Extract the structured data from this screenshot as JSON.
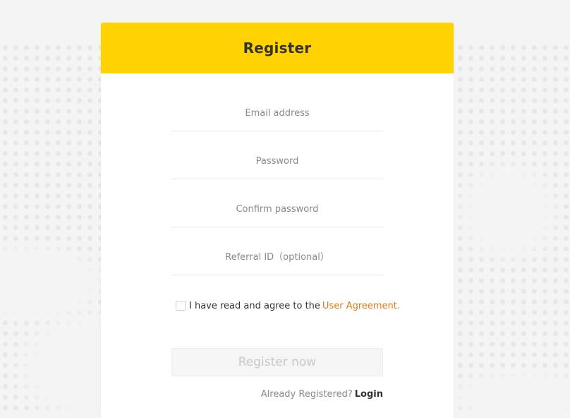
{
  "card": {
    "title": "Register"
  },
  "form": {
    "email_placeholder": "Email address",
    "password_placeholder": "Password",
    "confirm_password_placeholder": "Confirm password",
    "referral_placeholder": "Referral ID（optional）",
    "agree_text": "I have read and agree to the",
    "agreement_link": "User Agreement.",
    "submit_label": "Register now",
    "already_registered": "Already Registered?",
    "login_link": "Login"
  },
  "colors": {
    "accent": "#ffd200",
    "link": "#e07a12",
    "background": "#f4f4f4"
  }
}
